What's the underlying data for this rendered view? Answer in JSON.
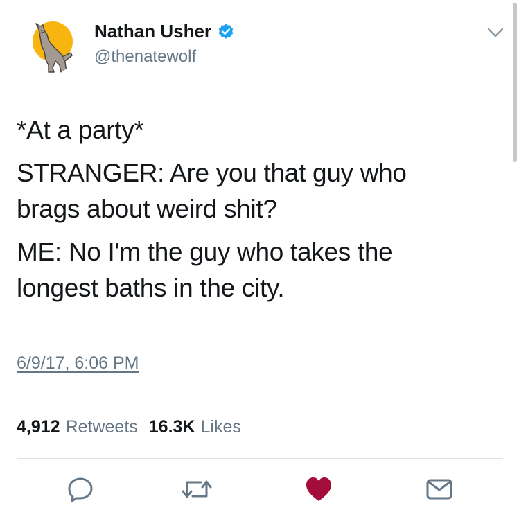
{
  "author": {
    "name": "Nathan Usher",
    "handle": "@thenatewolf",
    "verified": true,
    "avatar_icon": "howling-wolf-moon-avatar"
  },
  "tweet": {
    "lines": [
      "*At a party*",
      "STRANGER: Are you that guy who",
      "brags about weird shit?",
      "ME: No I'm the guy who takes the",
      "longest baths in the city."
    ],
    "timestamp": "6/9/17, 6:06 PM"
  },
  "stats": {
    "retweets_count": "4,912",
    "retweets_label": "Retweets",
    "likes_count": "16.3K",
    "likes_label": "Likes"
  },
  "actions": {
    "reply_icon": "reply-icon",
    "retweet_icon": "retweet-icon",
    "like_icon": "heart-icon",
    "like_state": "liked",
    "dm_icon": "envelope-icon"
  },
  "colors": {
    "text": "#14171a",
    "secondary": "#657786",
    "verified": "#1da1f2",
    "liked_heart": "#a30d3c",
    "divider": "#dfe3e6",
    "moon": "#f9b50f"
  }
}
